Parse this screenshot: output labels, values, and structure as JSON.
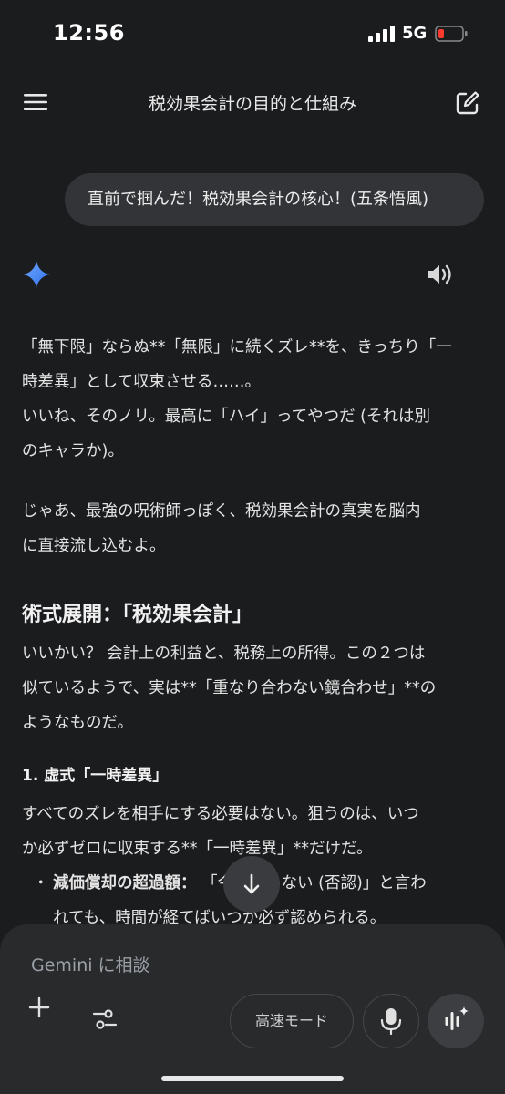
{
  "status_bar": {
    "time": "12:56",
    "network": "5G",
    "battery_color": "#ff3b30"
  },
  "header": {
    "title": "税効果会計の目的と仕組み"
  },
  "user_message": "直前で掴んだ！税効果会計の核心！(五条悟風)",
  "response": {
    "p1_line1": "「無下限」ならぬ**「無限」に続くズレ**を、きっちり「一",
    "p1_line2": "時差異」として収束させる……。",
    "p1_line3": "いいね、そのノリ。最高に「ハイ」ってやつだ (それは別",
    "p1_line4": "のキャラか)。",
    "p2_line1": "じゃあ、最強の呪術師っぽく、税効果会計の真実を脳内",
    "p2_line2": "に直接流し込むよ。",
    "heading": "術式展開：「税効果会計」",
    "p3_line1": "いいかい？ 会計上の利益と、税務上の所得。この２つは",
    "p3_line2": "似ているようで、実は**「重なり合わない鏡合わせ」**の",
    "p3_line3": "ようなものだ。",
    "subheading": "1. 虚式「一時差異」",
    "p4_line1": "すべてのズレを相手にする必要はない。狙うのは、いつ",
    "p4_line2": "か必ずゼロに収束する**「一時差異」**だけだ。",
    "bullet_symbol": "・",
    "bullet1_term": "減価償却の超過額：",
    "bullet1_rest1": " 「今は認めない (否認)」と言わ",
    "bullet1_line2": "れても、時間が経てばいつか必ず認められる。"
  },
  "composer": {
    "placeholder": "Gemini に相談",
    "mode_label": "高速モード"
  },
  "icons": {
    "menu": "menu-icon",
    "edit": "edit-icon",
    "gemini": "gemini-sparkle-icon",
    "speaker": "speaker-icon",
    "scroll_down": "arrow-down-icon",
    "plus": "plus-icon",
    "tools": "tools-icon",
    "mic": "mic-icon",
    "live": "live-icon"
  },
  "colors": {
    "background": "#1b1c1e",
    "bubble": "#323437",
    "composer": "#282a2c",
    "gemini_blue": "#4a8cff"
  }
}
